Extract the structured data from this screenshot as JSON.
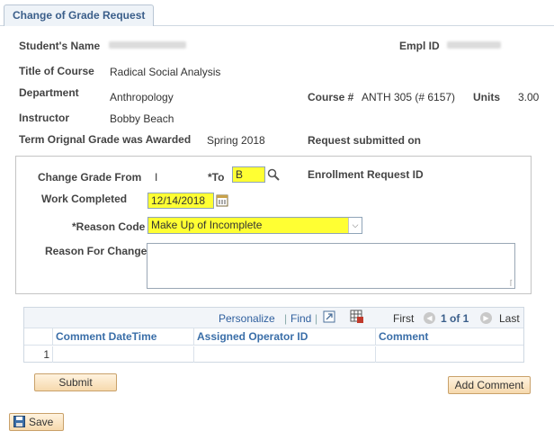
{
  "tab": {
    "label": "Change of Grade Request"
  },
  "student": {
    "name_label": "Student's Name",
    "empl_label": "Empl ID",
    "course_title_label": "Title of Course",
    "course_title": "Radical Social Analysis",
    "department_label": "Department",
    "department": "Anthropology",
    "course_num_label": "Course #",
    "course_num": "ANTH 305 (# 6157)",
    "units_label": "Units",
    "units": "3.00",
    "instructor_label": "Instructor",
    "instructor": "Bobby Beach",
    "term_label": "Term Orignal Grade was Awarded",
    "term": "Spring 2018",
    "submitted_label": "Request submitted on"
  },
  "form": {
    "change_from_label": "Change Grade From",
    "change_from_value": "I",
    "to_label": "*To",
    "to_value": "B",
    "enroll_req_label": "Enrollment Request ID",
    "work_completed_label": "Work Completed",
    "work_completed_value": "12/14/2018",
    "reason_code_label": "*Reason Code",
    "reason_code_value": "Make Up of Incomplete",
    "reason_change_label": "Reason For Change",
    "reason_change_value": ""
  },
  "grid": {
    "personalize": "Personalize",
    "find": "Find",
    "first": "First",
    "page_info": "1 of 1",
    "last": "Last",
    "columns": [
      "Comment DateTime",
      "Assigned Operator ID",
      "Comment"
    ],
    "rows": [
      {
        "num": "1",
        "datetime": "",
        "operator": "",
        "comment": ""
      }
    ]
  },
  "buttons": {
    "submit": "Submit",
    "add_comment": "Add Comment",
    "save": "Save"
  },
  "icons": {
    "lookup": "magnifier-icon",
    "calendar": "calendar-icon",
    "dropdown": "chevron-down-icon",
    "zoom": "zoom-grid-icon",
    "download": "download-excel-icon",
    "prev": "prev-arrow-icon",
    "next": "next-arrow-icon",
    "save": "floppy-disk-icon"
  }
}
